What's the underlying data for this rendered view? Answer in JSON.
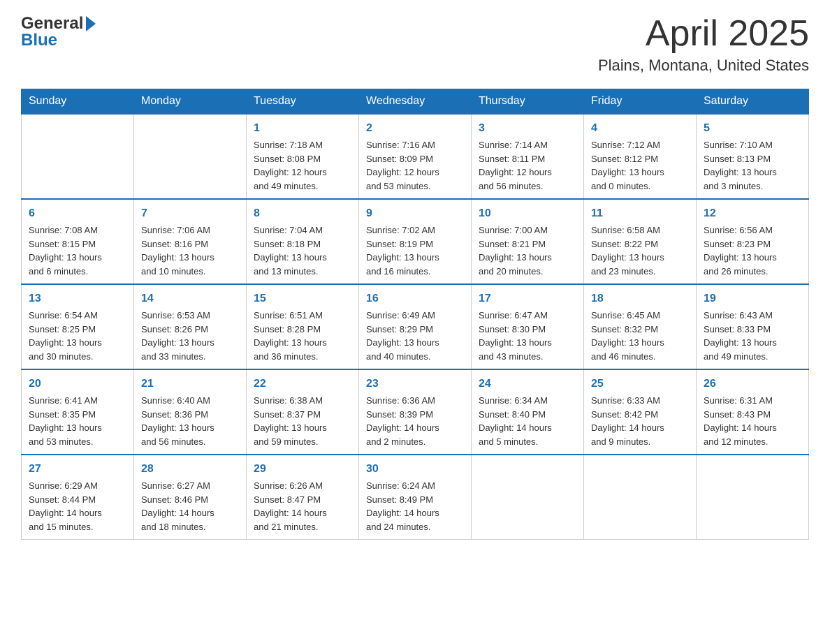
{
  "header": {
    "logo_general": "General",
    "logo_blue": "Blue",
    "month_title": "April 2025",
    "location": "Plains, Montana, United States"
  },
  "days_of_week": [
    "Sunday",
    "Monday",
    "Tuesday",
    "Wednesday",
    "Thursday",
    "Friday",
    "Saturday"
  ],
  "weeks": [
    [
      {
        "day": "",
        "info": ""
      },
      {
        "day": "",
        "info": ""
      },
      {
        "day": "1",
        "info": "Sunrise: 7:18 AM\nSunset: 8:08 PM\nDaylight: 12 hours\nand 49 minutes."
      },
      {
        "day": "2",
        "info": "Sunrise: 7:16 AM\nSunset: 8:09 PM\nDaylight: 12 hours\nand 53 minutes."
      },
      {
        "day": "3",
        "info": "Sunrise: 7:14 AM\nSunset: 8:11 PM\nDaylight: 12 hours\nand 56 minutes."
      },
      {
        "day": "4",
        "info": "Sunrise: 7:12 AM\nSunset: 8:12 PM\nDaylight: 13 hours\nand 0 minutes."
      },
      {
        "day": "5",
        "info": "Sunrise: 7:10 AM\nSunset: 8:13 PM\nDaylight: 13 hours\nand 3 minutes."
      }
    ],
    [
      {
        "day": "6",
        "info": "Sunrise: 7:08 AM\nSunset: 8:15 PM\nDaylight: 13 hours\nand 6 minutes."
      },
      {
        "day": "7",
        "info": "Sunrise: 7:06 AM\nSunset: 8:16 PM\nDaylight: 13 hours\nand 10 minutes."
      },
      {
        "day": "8",
        "info": "Sunrise: 7:04 AM\nSunset: 8:18 PM\nDaylight: 13 hours\nand 13 minutes."
      },
      {
        "day": "9",
        "info": "Sunrise: 7:02 AM\nSunset: 8:19 PM\nDaylight: 13 hours\nand 16 minutes."
      },
      {
        "day": "10",
        "info": "Sunrise: 7:00 AM\nSunset: 8:21 PM\nDaylight: 13 hours\nand 20 minutes."
      },
      {
        "day": "11",
        "info": "Sunrise: 6:58 AM\nSunset: 8:22 PM\nDaylight: 13 hours\nand 23 minutes."
      },
      {
        "day": "12",
        "info": "Sunrise: 6:56 AM\nSunset: 8:23 PM\nDaylight: 13 hours\nand 26 minutes."
      }
    ],
    [
      {
        "day": "13",
        "info": "Sunrise: 6:54 AM\nSunset: 8:25 PM\nDaylight: 13 hours\nand 30 minutes."
      },
      {
        "day": "14",
        "info": "Sunrise: 6:53 AM\nSunset: 8:26 PM\nDaylight: 13 hours\nand 33 minutes."
      },
      {
        "day": "15",
        "info": "Sunrise: 6:51 AM\nSunset: 8:28 PM\nDaylight: 13 hours\nand 36 minutes."
      },
      {
        "day": "16",
        "info": "Sunrise: 6:49 AM\nSunset: 8:29 PM\nDaylight: 13 hours\nand 40 minutes."
      },
      {
        "day": "17",
        "info": "Sunrise: 6:47 AM\nSunset: 8:30 PM\nDaylight: 13 hours\nand 43 minutes."
      },
      {
        "day": "18",
        "info": "Sunrise: 6:45 AM\nSunset: 8:32 PM\nDaylight: 13 hours\nand 46 minutes."
      },
      {
        "day": "19",
        "info": "Sunrise: 6:43 AM\nSunset: 8:33 PM\nDaylight: 13 hours\nand 49 minutes."
      }
    ],
    [
      {
        "day": "20",
        "info": "Sunrise: 6:41 AM\nSunset: 8:35 PM\nDaylight: 13 hours\nand 53 minutes."
      },
      {
        "day": "21",
        "info": "Sunrise: 6:40 AM\nSunset: 8:36 PM\nDaylight: 13 hours\nand 56 minutes."
      },
      {
        "day": "22",
        "info": "Sunrise: 6:38 AM\nSunset: 8:37 PM\nDaylight: 13 hours\nand 59 minutes."
      },
      {
        "day": "23",
        "info": "Sunrise: 6:36 AM\nSunset: 8:39 PM\nDaylight: 14 hours\nand 2 minutes."
      },
      {
        "day": "24",
        "info": "Sunrise: 6:34 AM\nSunset: 8:40 PM\nDaylight: 14 hours\nand 5 minutes."
      },
      {
        "day": "25",
        "info": "Sunrise: 6:33 AM\nSunset: 8:42 PM\nDaylight: 14 hours\nand 9 minutes."
      },
      {
        "day": "26",
        "info": "Sunrise: 6:31 AM\nSunset: 8:43 PM\nDaylight: 14 hours\nand 12 minutes."
      }
    ],
    [
      {
        "day": "27",
        "info": "Sunrise: 6:29 AM\nSunset: 8:44 PM\nDaylight: 14 hours\nand 15 minutes."
      },
      {
        "day": "28",
        "info": "Sunrise: 6:27 AM\nSunset: 8:46 PM\nDaylight: 14 hours\nand 18 minutes."
      },
      {
        "day": "29",
        "info": "Sunrise: 6:26 AM\nSunset: 8:47 PM\nDaylight: 14 hours\nand 21 minutes."
      },
      {
        "day": "30",
        "info": "Sunrise: 6:24 AM\nSunset: 8:49 PM\nDaylight: 14 hours\nand 24 minutes."
      },
      {
        "day": "",
        "info": ""
      },
      {
        "day": "",
        "info": ""
      },
      {
        "day": "",
        "info": ""
      }
    ]
  ]
}
